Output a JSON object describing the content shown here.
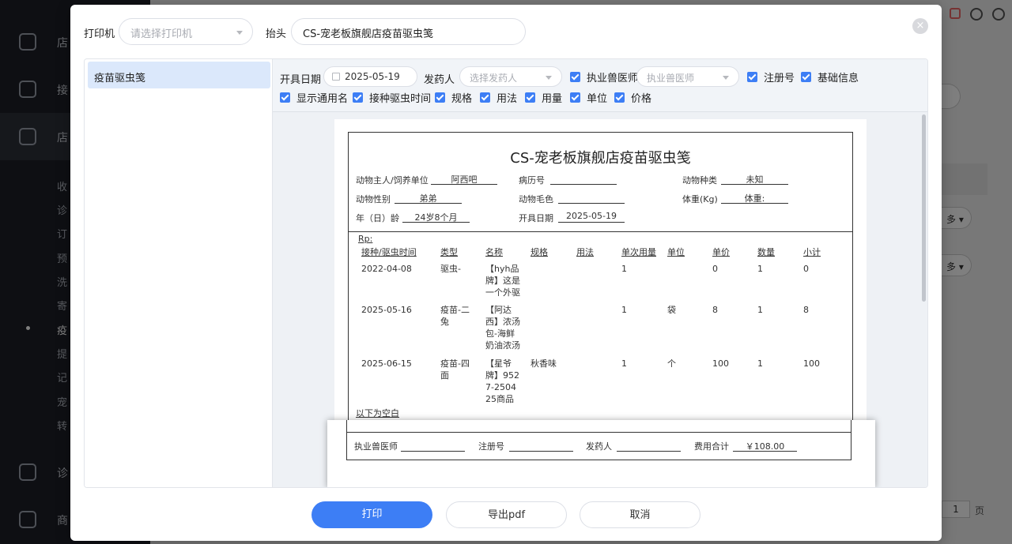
{
  "background": {
    "nav_primary": [
      "店",
      "接",
      "店"
    ],
    "sub_items": [
      "收",
      "诊",
      "订",
      "预",
      "洗",
      "寄",
      "疫",
      "提",
      "记",
      "宠",
      "转"
    ],
    "nav_secondary": [
      "诊",
      "商"
    ],
    "right_snippets": {
      "more_1": "多",
      "more_2": "多",
      "page_num": "1",
      "page_unit": "页"
    }
  },
  "dialog": {
    "printer_label": "打印机",
    "printer_placeholder": "请选择打印机",
    "header_label": "抬头",
    "header_value": "CS-宠老板旗舰店疫苗驱虫笺",
    "close_symbol": "×",
    "template_list": [
      "疫苗驱虫笺"
    ],
    "options": {
      "issue_date_label": "开具日期",
      "issue_date_value": "2025-05-19",
      "dispenser_label": "发药人",
      "dispenser_placeholder": "选择发药人",
      "vet_label": "执业兽医师",
      "vet_placeholder": "执业兽医师",
      "reg_no_label": "注册号",
      "basic_info_label": "基础信息",
      "show_generic_label": "显示通用名",
      "vacc_time_label": "接种驱虫时间",
      "spec_label": "规格",
      "usage_label": "用法",
      "dosage_label": "用量",
      "unit_label": "单位",
      "price_label": "价格"
    },
    "buttons": {
      "print": "打印",
      "export": "导出pdf",
      "cancel": "取消"
    }
  },
  "prescription": {
    "title": "CS-宠老板旗舰店疫苗驱虫笺",
    "owner_label": "动物主人/饲养单位",
    "owner_value": "阿西吧",
    "record_label": "病历号",
    "record_value": "",
    "species_label": "动物种类",
    "species_value": "未知",
    "sex_label": "动物性别",
    "sex_value": "弟弟",
    "coat_label": "动物毛色",
    "coat_value": "",
    "weight_label": "体重(Kg)",
    "weight_value": "体重:",
    "age_label": "年（日）龄",
    "age_value": "24岁8个月",
    "date_label": "开具日期",
    "date_value": "2025-05-19",
    "rp": "Rp:",
    "columns": [
      "接种/驱虫时间",
      "类型",
      "名称",
      "规格",
      "用法",
      "单次用量",
      "单位",
      "单价",
      "数量",
      "小计"
    ],
    "rows": [
      {
        "time": "2022-04-08",
        "type": [
          "驱虫-"
        ],
        "name": [
          "【hyh品",
          "牌】这是",
          "一个外驱"
        ],
        "spec": "",
        "usage": "",
        "dose": "1",
        "unit": "",
        "price": "0",
        "qty": "1",
        "subtotal": "0"
      },
      {
        "time": "2025-05-16",
        "type": [
          "疫苗-二",
          "兔"
        ],
        "name": [
          "【阿达",
          "西】浓汤",
          "包-海鲜",
          "奶油浓汤"
        ],
        "spec": "",
        "usage": "",
        "dose": "1",
        "unit": "袋",
        "price": "8",
        "qty": "1",
        "subtotal": "8"
      },
      {
        "time": "2025-06-15",
        "type": [
          "疫苗-四",
          "面"
        ],
        "name": [
          "【星爷",
          "牌】952",
          "7-2504",
          "25商品"
        ],
        "spec": "秋香味",
        "usage": "",
        "dose": "1",
        "unit": "个",
        "price": "100",
        "qty": "1",
        "subtotal": "100"
      }
    ],
    "blank_note": "以下为空白",
    "footer": {
      "vet_label": "执业兽医师",
      "vet_value": "",
      "reg_label": "注册号",
      "reg_value": "",
      "dispenser_label": "发药人",
      "dispenser_value": "",
      "total_label": "费用合计",
      "total_value": "￥108.00"
    }
  },
  "colors": {
    "primary": "#3d7ef5",
    "selected_bg": "#dbe8fb",
    "sidebar": "#1c1f26"
  }
}
